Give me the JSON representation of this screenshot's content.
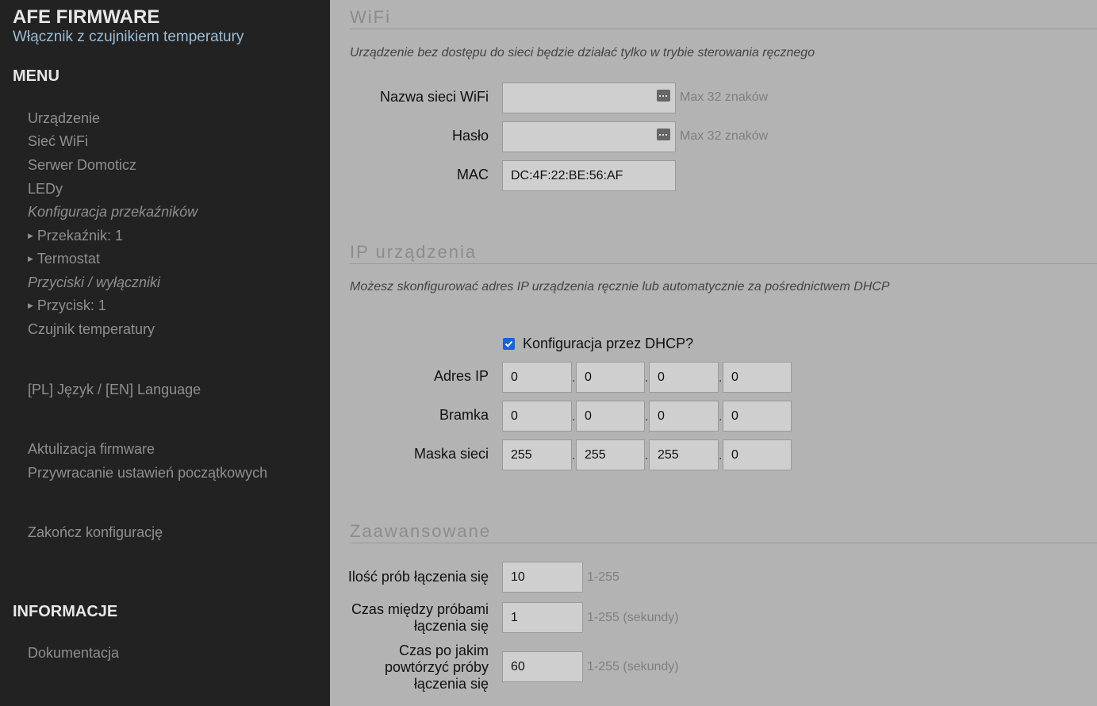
{
  "sidebar": {
    "brand": "AFE FIRMWARE",
    "subtitle": "Włącznik z czujnikiem temperatury",
    "menu_heading": "MENU",
    "items": {
      "urzadzenie": "Urządzenie",
      "siec_wifi": "Sieć WiFi",
      "serwer_domoticz": "Serwer Domoticz",
      "ledy": "LEDy",
      "group_przekazniki": "Konfiguracja przekaźników",
      "przekaznik_1": "Przekaźnik: 1",
      "termostat": "Termostat",
      "group_przyciski": "Przyciski / wyłączniki",
      "przycisk_1": "Przycisk: 1",
      "czujnik": "Czujnik temperatury",
      "jezyk": "[PL] Język / [EN] Language",
      "aktualizacja": "Aktulizacja firmware",
      "przywracanie": "Przywracanie ustawień początkowych",
      "zakoncz": "Zakończ konfigurację"
    },
    "info_heading": "INFORMACJE",
    "info_items": {
      "dokumentacja": "Dokumentacja"
    }
  },
  "wifi": {
    "title": "WiFi",
    "description": "Urządzenie bez dostępu do sieci będzie działać tylko w trybie sterowania ręcznego",
    "ssid_label": "Nazwa sieci WiFi",
    "ssid_value": "",
    "ssid_hint": "Max 32 znaków",
    "password_label": "Hasło",
    "password_value": "",
    "password_hint": "Max 32 znaków",
    "mac_label": "MAC",
    "mac_value": "DC:4F:22:BE:56:AF"
  },
  "ip": {
    "title": "IP urządzenia",
    "description": "Możesz skonfigurować adres IP urządzenia ręcznie lub automatycznie za pośrednictwem DHCP",
    "dhcp_label": "Konfiguracja przez DHCP?",
    "dhcp_checked": true,
    "separator": ".",
    "ip_label": "Adres IP",
    "ip": [
      "0",
      "0",
      "0",
      "0"
    ],
    "gateway_label": "Bramka",
    "gateway": [
      "0",
      "0",
      "0",
      "0"
    ],
    "mask_label": "Maska sieci",
    "mask": [
      "255",
      "255",
      "255",
      "0"
    ]
  },
  "advanced": {
    "title": "Zaawansowane",
    "attempts_label": "Ilość prób łączenia się",
    "attempts_value": "10",
    "attempts_hint": "1-255",
    "delay_label_1": "Czas między próbami",
    "delay_label_2": "łączenia się",
    "delay_value": "1",
    "delay_hint": "1-255 (sekundy)",
    "retry_label_1": "Czas po jakim",
    "retry_label_2": "powtórzyć próby",
    "retry_label_3": "łączenia się",
    "retry_value": "60",
    "retry_hint": "1-255 (sekundy)"
  },
  "colors": {
    "sidebar_bg": "#222222",
    "main_bg": "#b3b3b3",
    "subtitle": "#9dbcd4",
    "checkbox": "#1a62d6"
  }
}
